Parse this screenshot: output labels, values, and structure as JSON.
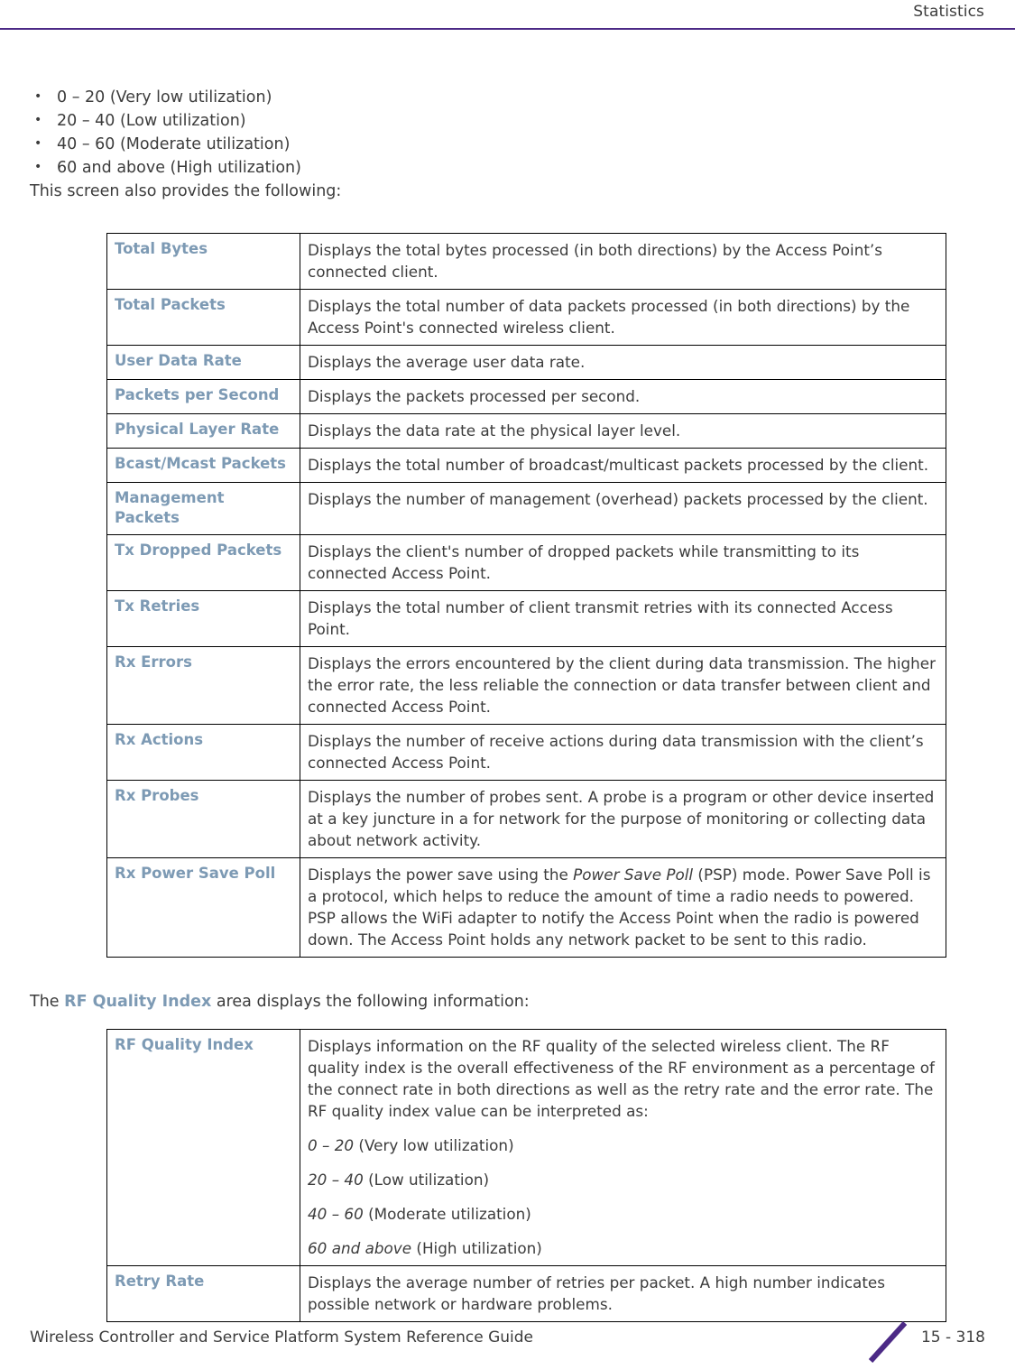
{
  "header": {
    "title": "Statistics",
    "rule_color": "#4c2a86"
  },
  "theme": {
    "keyword_color": "#7d9ab4",
    "body_text_color": "#3c3c3c",
    "accent_purple": "#4c2a86"
  },
  "intro": {
    "bullets": [
      "0 – 20 (Very low utilization)",
      "20 – 40 (Low utilization)",
      "40 – 60 (Moderate utilization)",
      "60 and above (High utilization)"
    ],
    "lead_in": "This screen also provides the following:"
  },
  "table_stats": {
    "rows": [
      {
        "label": "Total Bytes",
        "desc": "Displays the total bytes processed (in both directions) by the Access Point’s connected client."
      },
      {
        "label": "Total Packets",
        "desc": "Displays the total number of data packets processed (in both directions) by the Access Point's connected wireless client."
      },
      {
        "label": "User Data Rate",
        "desc": "Displays the average user data rate."
      },
      {
        "label": "Packets per Second",
        "desc": "Displays the packets processed per second."
      },
      {
        "label": "Physical Layer Rate",
        "desc": "Displays the data rate at the physical layer level."
      },
      {
        "label": "Bcast/Mcast Packets",
        "desc": "Displays the total number of broadcast/multicast packets processed by the client."
      },
      {
        "label": "Management Packets",
        "desc": "Displays the number of management (overhead) packets processed by the client."
      },
      {
        "label": "Tx Dropped Packets",
        "desc": "Displays the client's number of dropped packets while transmitting to its connected Access Point."
      },
      {
        "label": "Tx Retries",
        "desc": "Displays the total number of client transmit retries with its connected Access Point."
      },
      {
        "label": "Rx Errors",
        "desc": "Displays the errors encountered by the client during data transmission. The higher the error rate, the less reliable the connection or data transfer between client and connected Access Point."
      },
      {
        "label": "Rx Actions",
        "desc": "Displays the number of receive actions during data transmission with the client’s connected Access Point."
      },
      {
        "label": "Rx Probes",
        "desc": "Displays the number of probes sent. A probe is a program or other device inserted at a key juncture in a for network for the purpose of monitoring or collecting data about network activity."
      }
    ],
    "rx_power_save_poll": {
      "label": "Rx Power Save Poll",
      "desc_part1": "Displays the power save using the ",
      "desc_italic": "Power Save Poll",
      "desc_part2": " (PSP) mode. Power Save Poll is a protocol, which helps to reduce the amount of time a radio needs to powered. PSP allows the WiFi adapter to notify the Access Point when the radio is powered down. The Access Point holds any network packet to be sent to this radio."
    }
  },
  "mid_paragraph": {
    "before": "The ",
    "keyword": "RF Quality Index",
    "after": " area displays the following information:"
  },
  "table_rf": {
    "rf_quality_index": {
      "label": "RF Quality Index",
      "desc_main": "Displays information on the RF quality of the selected wireless client. The RF quality index is the overall effectiveness of the RF environment as a percentage of the connect rate in both directions as well as the retry rate and the error rate. The RF quality index value can be interpreted as:",
      "ranges": [
        {
          "value": "0 – 20",
          "meaning": " (Very low utilization)"
        },
        {
          "value": "20 – 40",
          "meaning": " (Low utilization)"
        },
        {
          "value": "40 – 60",
          "meaning": " (Moderate utilization)"
        },
        {
          "value": "60 and above",
          "meaning": " (High utilization)"
        }
      ]
    },
    "retry_rate": {
      "label": "Retry Rate",
      "desc": "Displays the average number of retries per packet. A high number indicates possible network or hardware problems."
    }
  },
  "footer": {
    "guide_title": "Wireless Controller and Service Platform System Reference Guide",
    "page_number": "15 - 318"
  }
}
